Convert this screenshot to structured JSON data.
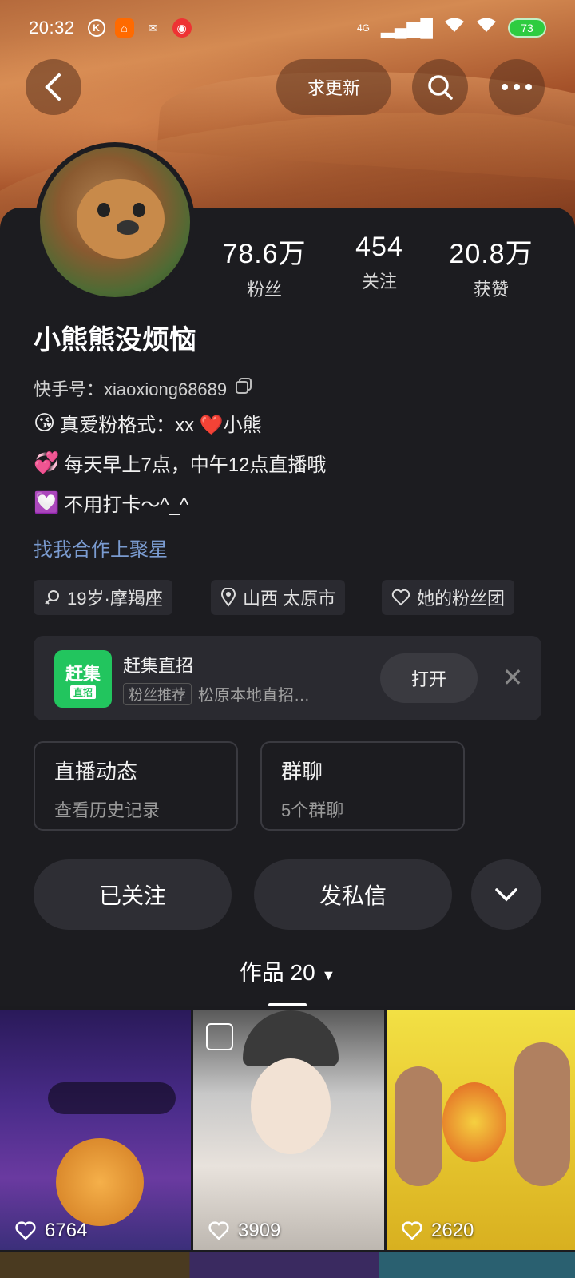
{
  "status_bar": {
    "time": "20:32",
    "network": "4G",
    "battery": "73"
  },
  "header": {
    "update_label": "求更新"
  },
  "profile": {
    "name": "小熊熊没烦恼",
    "kuaishou_id_label": "快手号：xiaoxiong68689",
    "stats": [
      {
        "value": "78.6万",
        "label": "粉丝"
      },
      {
        "value": "454",
        "label": "关注"
      },
      {
        "value": "20.8万",
        "label": "获赞"
      }
    ],
    "bio": [
      {
        "emoji": "😘",
        "text": "真爱粉格式：xx ❤️小熊"
      },
      {
        "emoji": "💞",
        "text": "每天早上7点，中午12点直播哦"
      },
      {
        "emoji": "💟",
        "text": "不用打卡～^_^"
      }
    ],
    "link_text": "找我合作上聚星",
    "tags": [
      {
        "icon": "gender-female-icon",
        "text": "19岁·摩羯座"
      },
      {
        "icon": "location-pin-icon",
        "text": "山西 太原市"
      },
      {
        "icon": "heart-outline-icon",
        "text": "她的粉丝团"
      }
    ]
  },
  "promo": {
    "logo_text": "赶集",
    "logo_sub": "直招",
    "title": "赶集直招",
    "badge": "粉丝推荐",
    "subtitle": "松原本地直招…",
    "open_label": "打开"
  },
  "cards": [
    {
      "title": "直播动态",
      "sub": "查看历史记录"
    },
    {
      "title": "群聊",
      "sub": "5个群聊"
    }
  ],
  "actions": {
    "follow_label": "已关注",
    "message_label": "发私信"
  },
  "tab": {
    "label": "作品 20"
  },
  "videos": [
    {
      "likes": "6764"
    },
    {
      "likes": "3909"
    },
    {
      "likes": "2620"
    }
  ]
}
